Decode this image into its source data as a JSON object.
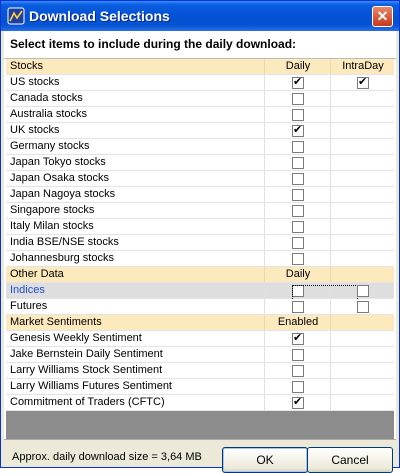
{
  "window": {
    "title": "Download Selections",
    "close_icon": "✕"
  },
  "header": {
    "text": "Select items to include during the daily download:"
  },
  "grid": {
    "sections": [
      {
        "name": "Stocks",
        "col1": "Daily",
        "col2": "IntraDay",
        "rows": [
          {
            "label": "US stocks",
            "c1": true,
            "c2": true
          },
          {
            "label": "Canada stocks",
            "c1": false
          },
          {
            "label": "Australia stocks",
            "c1": false
          },
          {
            "label": "UK stocks",
            "c1": true
          },
          {
            "label": "Germany stocks",
            "c1": false
          },
          {
            "label": "Japan Tokyo stocks",
            "c1": false
          },
          {
            "label": "Japan Osaka stocks",
            "c1": false
          },
          {
            "label": "Japan Nagoya stocks",
            "c1": false
          },
          {
            "label": "Singapore stocks",
            "c1": false
          },
          {
            "label": "Italy Milan stocks",
            "c1": false
          },
          {
            "label": "India BSE/NSE stocks",
            "c1": false
          },
          {
            "label": "Johannesburg stocks",
            "c1": false
          }
        ]
      },
      {
        "name": "Other Data",
        "col1": "Daily",
        "col2": "",
        "rows": [
          {
            "label": "Indices",
            "c1": false,
            "c2": false,
            "highlighted": true
          },
          {
            "label": "Futures",
            "c1": false,
            "c2": false
          }
        ]
      },
      {
        "name": "Market Sentiments",
        "col1": "Enabled",
        "col2": "",
        "rows": [
          {
            "label": "Genesis Weekly Sentiment",
            "c1": true
          },
          {
            "label": "Jake Bernstein Daily Sentiment",
            "c1": false
          },
          {
            "label": "Larry Williams Stock Sentiment",
            "c1": false
          },
          {
            "label": "Larry Williams Futures Sentiment",
            "c1": false
          },
          {
            "label": "Commitment of Traders (CFTC)",
            "c1": true
          }
        ]
      }
    ]
  },
  "footer": {
    "size_text": "Approx. daily download size = 3,64 MB",
    "ok_label": "OK",
    "cancel_label": "Cancel"
  },
  "colors": {
    "title_bar": "#0552d6",
    "section_bg": "#fde9be",
    "highlight_text": "#1f4fd1",
    "grid_bg": "#8c8c8c"
  }
}
